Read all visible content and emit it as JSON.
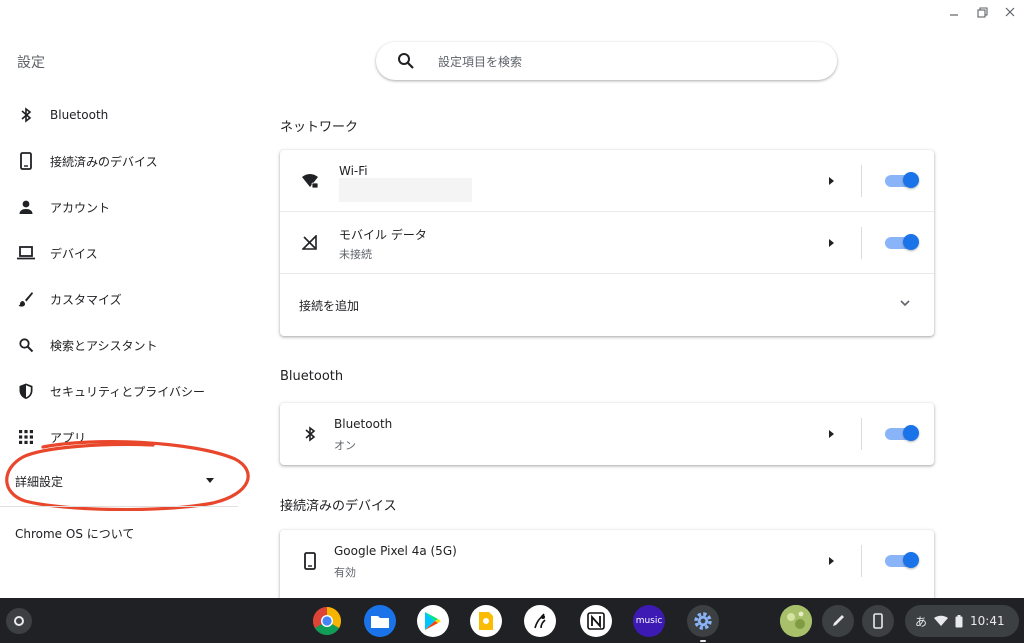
{
  "app": {
    "title": "設定"
  },
  "search": {
    "placeholder": "設定項目を検索"
  },
  "sidebar": {
    "items": [
      {
        "label": "Bluetooth",
        "icon": "bluetooth-icon"
      },
      {
        "label": "接続済みのデバイス",
        "icon": "phone-icon"
      },
      {
        "label": "アカウント",
        "icon": "person-icon"
      },
      {
        "label": "デバイス",
        "icon": "laptop-icon"
      },
      {
        "label": "カスタマイズ",
        "icon": "brush-icon"
      },
      {
        "label": "検索とアシスタント",
        "icon": "search-icon"
      },
      {
        "label": "セキュリティとプライバシー",
        "icon": "shield-icon"
      },
      {
        "label": "アプリ",
        "icon": "apps-grid-icon"
      }
    ],
    "advanced": "詳細設定",
    "about": "Chrome OS について"
  },
  "sections": {
    "network": {
      "title": "ネットワーク",
      "wifi": {
        "label": "Wi-Fi",
        "enabled": true
      },
      "mobile": {
        "label": "モバイル データ",
        "status": "未接続",
        "enabled": true
      },
      "add": {
        "label": "接続を追加"
      }
    },
    "bluetooth": {
      "title": "Bluetooth",
      "row": {
        "label": "Bluetooth",
        "status": "オン",
        "enabled": true
      }
    },
    "connected": {
      "title": "接続済みのデバイス",
      "row": {
        "label": "Google Pixel 4a (5G)",
        "status": "有効",
        "enabled": true
      }
    }
  },
  "shelf": {
    "apps": [
      "Chrome",
      "Files",
      "Play Store",
      "Keep",
      "Kindle",
      "Notion",
      "Amazon Music",
      "Settings"
    ],
    "music_label": "music",
    "ime": "あ",
    "time": "10:41"
  },
  "colors": {
    "accent": "#1a73e8",
    "toggle_track": "#8ab4f8",
    "annotation": "#e8472b",
    "shelf": "#202124"
  }
}
